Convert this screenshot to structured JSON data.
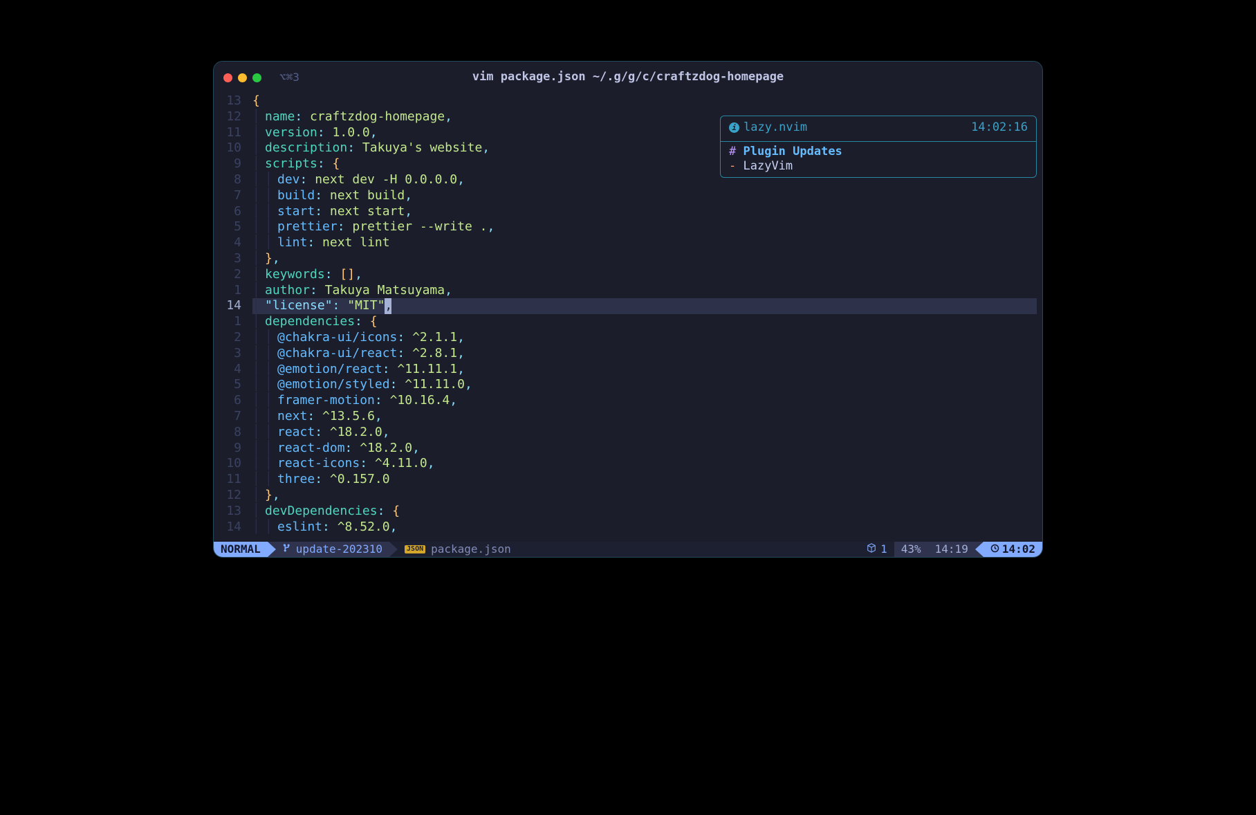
{
  "window": {
    "tab_label": "⌥⌘3",
    "title": "vim package.json ~/.g/g/c/craftzdog-homepage"
  },
  "gutter": {
    "lines": [
      "13",
      "12",
      "11",
      "10",
      "9",
      "8",
      "7",
      "6",
      "5",
      "4",
      "3",
      "2",
      "1",
      "14",
      "1",
      "2",
      "3",
      "4",
      "5",
      "6",
      "7",
      "8",
      "9",
      "10",
      "11",
      "12",
      "13",
      "14"
    ],
    "current_index": 13
  },
  "code": {
    "lines": [
      {
        "open_brace": "{"
      },
      {
        "indent": 1,
        "key1": "name",
        "val": "craftzdog-homepage",
        "trail": ","
      },
      {
        "indent": 1,
        "key1": "version",
        "val": "1.0.0",
        "trail": ","
      },
      {
        "indent": 1,
        "key1": "description",
        "val": "Takuya's website",
        "trail": ","
      },
      {
        "indent": 1,
        "key1": "scripts",
        "brace": "{"
      },
      {
        "indent": 2,
        "key2": "dev",
        "val": "next dev -H 0.0.0.0",
        "trail": ","
      },
      {
        "indent": 2,
        "key2": "build",
        "val": "next build",
        "trail": ","
      },
      {
        "indent": 2,
        "key2": "start",
        "val": "next start",
        "trail": ","
      },
      {
        "indent": 2,
        "key2": "prettier",
        "val": "prettier --write .",
        "trail": ","
      },
      {
        "indent": 2,
        "key2": "lint",
        "val": "next lint"
      },
      {
        "indent": 1,
        "closebrace": "}",
        "trail": ","
      },
      {
        "indent": 1,
        "key1": "keywords",
        "array": "[]",
        "trail": ","
      },
      {
        "indent": 1,
        "key1": "author",
        "val": "Takuya Matsuyama",
        "trail": ","
      },
      {
        "indent": 1,
        "cursor": true,
        "qkey": "\"license\"",
        "qval": "\"MIT\"",
        "cursor_char": ","
      },
      {
        "indent": 1,
        "key1": "dependencies",
        "brace": "{"
      },
      {
        "indent": 2,
        "key2": "@chakra-ui/icons",
        "val": "^2.1.1",
        "trail": ","
      },
      {
        "indent": 2,
        "key2": "@chakra-ui/react",
        "val": "^2.8.1",
        "trail": ","
      },
      {
        "indent": 2,
        "key2": "@emotion/react",
        "val": "^11.11.1",
        "trail": ","
      },
      {
        "indent": 2,
        "key2": "@emotion/styled",
        "val": "^11.11.0",
        "trail": ","
      },
      {
        "indent": 2,
        "key2": "framer-motion",
        "val": "^10.16.4",
        "trail": ","
      },
      {
        "indent": 2,
        "key2": "next",
        "val": "^13.5.6",
        "trail": ","
      },
      {
        "indent": 2,
        "key2": "react",
        "val": "^18.2.0",
        "trail": ","
      },
      {
        "indent": 2,
        "key2": "react-dom",
        "val": "^18.2.0",
        "trail": ","
      },
      {
        "indent": 2,
        "key2": "react-icons",
        "val": "^4.11.0",
        "trail": ","
      },
      {
        "indent": 2,
        "key2": "three",
        "val": "^0.157.0"
      },
      {
        "indent": 1,
        "closebrace": "}",
        "trail": ","
      },
      {
        "indent": 1,
        "key1": "devDependencies",
        "brace": "{"
      },
      {
        "indent": 2,
        "key2": "eslint",
        "val": "^8.52.0",
        "trail": ","
      }
    ]
  },
  "popup": {
    "title": "lazy.nvim",
    "time": "14:02:16",
    "heading_prefix": "#",
    "heading": "Plugin Updates",
    "item_prefix": "-",
    "item": "LazyVim"
  },
  "status": {
    "mode": "NORMAL",
    "branch": "update-202310",
    "file": "package.json",
    "diag_count": "1",
    "percent": "43%",
    "position": "14:19",
    "clock": "14:02",
    "json_badge": "JSON"
  }
}
